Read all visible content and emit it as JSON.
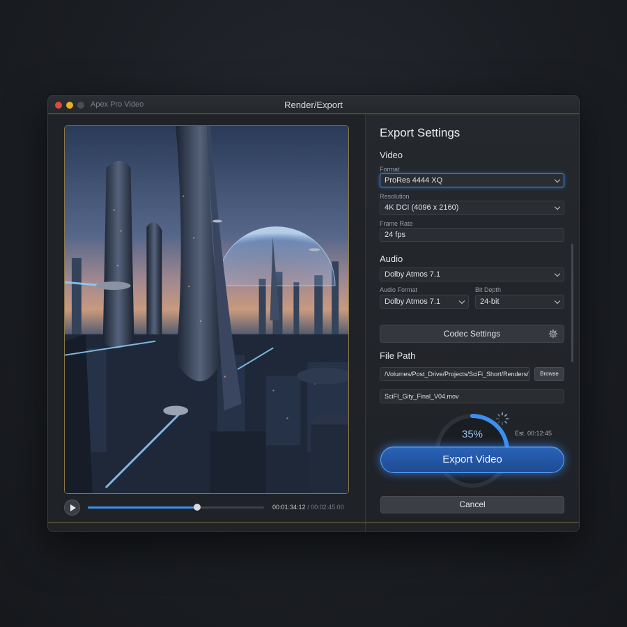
{
  "window": {
    "app_name": "Apex Pro Video",
    "title": "Render/Export"
  },
  "player": {
    "current_time": "00:01:34:12",
    "separator": "/",
    "total_time": "00:02:45:00",
    "progress": 0.62
  },
  "export": {
    "title": "Export Settings",
    "video": {
      "section": "Video",
      "format_label": "Format",
      "format_value": "ProRes 4444 XQ",
      "resolution_label": "Resolution",
      "resolution_value": "4K DCI (4096 x 2160)",
      "frame_rate_label": "Frame Rate",
      "frame_rate_value": "24 fps"
    },
    "audio": {
      "section": "Audio",
      "preset_value": "Dolby Atmos 7.1",
      "format_label": "Audio Format",
      "format_value": "Dolby Atmos 7.1",
      "bit_depth_label": "Bit Depth",
      "bit_depth_value": "24-bit"
    },
    "codec_settings_label": "Codec Settings",
    "file_path": {
      "section": "File Path",
      "path_value": "/Volumes/Post_Drive/Projects/SciFi_Short/Renders/",
      "browse_label": "Browse",
      "filename_value": "SciFI_Gity_Final_V04.mov"
    },
    "progress_percent": "35%",
    "progress_fraction": 0.35,
    "estimate": "Est. 00:12:45",
    "export_button_label": "Export Video",
    "cancel_button_label": "Cancel",
    "accent_color": "#3c8ff0"
  }
}
